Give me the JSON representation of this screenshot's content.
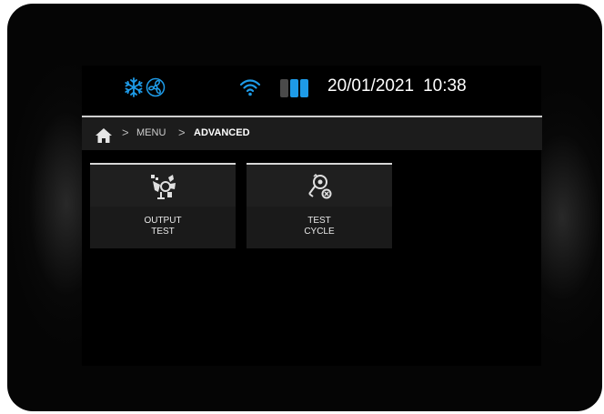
{
  "status": {
    "icons": [
      "snowflake-icon",
      "fan-icon",
      "wifi-icon"
    ],
    "accent_color": "#1e9be8",
    "level_bars": {
      "total": 3,
      "active": 2,
      "active_color": "#1e9be8",
      "inactive_color": "#4a4a4a"
    },
    "date": "20/01/2021",
    "time": "10:38"
  },
  "breadcrumb": {
    "home_icon": "home-icon",
    "separator": ">",
    "items": [
      "MENU",
      "ADVANCED"
    ]
  },
  "tiles": [
    {
      "icon": "output-test-icon",
      "line1": "OUTPUT",
      "line2": "TEST"
    },
    {
      "icon": "test-cycle-icon",
      "line1": "TEST",
      "line2": "CYCLE"
    }
  ]
}
